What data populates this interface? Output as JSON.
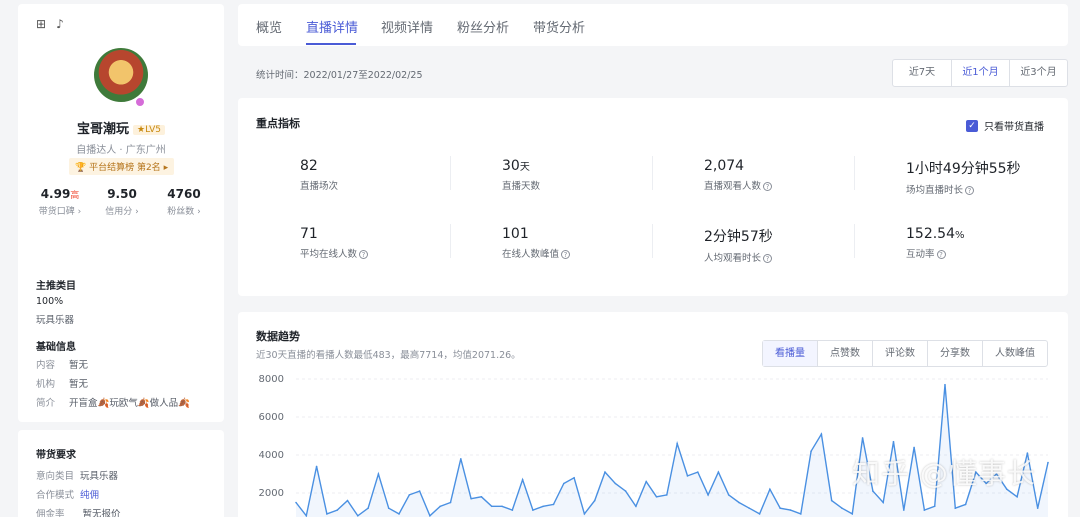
{
  "sidebar": {
    "icons": [
      "grid-icon",
      "tiktok-icon"
    ],
    "name": "宝哥潮玩",
    "level": "★LV5",
    "sub_info": "自播达人 · 广东广州",
    "rank": "平台结算榜 第2名",
    "scores": [
      {
        "value": "4.99",
        "tag": "高",
        "label": "带货口碑"
      },
      {
        "value": "9.50",
        "tag": "",
        "label": "信用分"
      },
      {
        "value": "4760",
        "tag": "",
        "label": "粉丝数"
      }
    ],
    "main_category": {
      "title": "主推类目",
      "percent": "100%",
      "name": "玩具乐器"
    },
    "basic_info": {
      "title": "基础信息",
      "rows": [
        {
          "key": "内容",
          "value": "暂无"
        },
        {
          "key": "机构",
          "value": "暂无"
        },
        {
          "key": "简介",
          "value": "开盲盒🍂玩欧气🍂做人品🍂"
        }
      ]
    },
    "requirements": {
      "title": "带货要求",
      "rows": [
        {
          "key": "意向类目",
          "value": "玩具乐器"
        },
        {
          "key": "合作模式",
          "value": "纯佣"
        },
        {
          "key": "佣金率",
          "value": "暂无报价"
        }
      ]
    }
  },
  "tabs": [
    "概览",
    "直播详情",
    "视频详情",
    "粉丝分析",
    "带货分析"
  ],
  "active_tab": "直播详情",
  "stat_time": "统计时间：2022/01/27至2022/02/25",
  "ranges": [
    "近7天",
    "近1个月",
    "近3个月"
  ],
  "active_range": "近1个月",
  "metrics": {
    "title": "重点指标",
    "only_live_label": "只看带货直播",
    "only_live_checked": true,
    "items": [
      {
        "value": "82",
        "unit": "",
        "label": "直播场次",
        "help": false
      },
      {
        "value": "30",
        "unit": "天",
        "label": "直播天数",
        "help": false
      },
      {
        "value": "2,074",
        "unit": "",
        "label": "直播观看人数",
        "help": true
      },
      {
        "value": "1小时49分钟55秒",
        "unit": "",
        "label": "场均直播时长",
        "help": true
      },
      {
        "value": "71",
        "unit": "",
        "label": "平均在线人数",
        "help": true
      },
      {
        "value": "101",
        "unit": "",
        "label": "在线人数峰值",
        "help": true
      },
      {
        "value": "2分钟57秒",
        "unit": "",
        "label": "人均观看时长",
        "help": true
      },
      {
        "value": "152.54",
        "unit": "%",
        "label": "互动率",
        "help": true
      }
    ]
  },
  "trend": {
    "title": "数据趋势",
    "subtitle": "近30天直播的看播人数最低483，最高7714，均值2071.26。",
    "segments": [
      "看播量",
      "点赞数",
      "评论数",
      "分享数",
      "人数峰值"
    ],
    "active_segment": "看播量"
  },
  "watermark": "知乎 @懂事长",
  "colors": {
    "accent": "#4a5bd6",
    "line": "#4a90e2"
  },
  "chart_data": {
    "type": "line",
    "ylim": [
      0,
      8000
    ],
    "yticks": [
      "8000",
      "6000",
      "4000",
      "2000"
    ],
    "grid": true,
    "series": [
      {
        "values": [
          1500,
          800,
          3400,
          900,
          1100,
          1600,
          800,
          1200,
          3000,
          1200,
          900,
          1900,
          2100,
          800,
          1300,
          1500,
          3800,
          1700,
          1800,
          1300,
          1300,
          1100,
          2700,
          1100,
          1300,
          1400,
          2500,
          2800,
          900,
          1600,
          3100,
          2500,
          2100,
          1300,
          2600,
          1800,
          1900,
          4600,
          2900,
          3100,
          1900,
          3100,
          1900,
          1500,
          1200,
          900,
          2200,
          1200,
          1100,
          900,
          4200,
          5100,
          1600,
          1200,
          900,
          4900,
          2100,
          1500,
          4700,
          1100,
          4400,
          1100,
          1300,
          7700,
          1200,
          1400,
          3100,
          2500,
          3000,
          2200,
          1800,
          4100,
          1200,
          3600
        ]
      }
    ]
  }
}
